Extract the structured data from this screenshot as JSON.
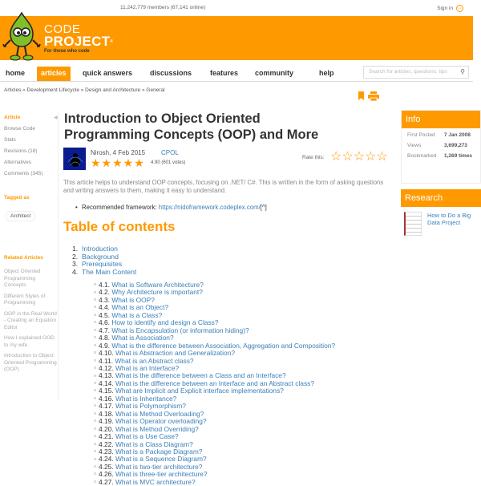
{
  "header": {
    "members": "11,242,779 members (67,141 online)",
    "sign_in": "Sign in",
    "logo_code": "CODE",
    "logo_project": "PROJECT",
    "logo_reg": "®",
    "logo_tagline": "For those who code",
    "brand_color": "#ff9900"
  },
  "nav": {
    "items": [
      {
        "label": "home",
        "active": false
      },
      {
        "label": "articles",
        "active": true
      },
      {
        "label": "quick answers",
        "active": false
      },
      {
        "label": "discussions",
        "active": false
      },
      {
        "label": "features",
        "active": false
      },
      {
        "label": "community",
        "active": false
      },
      {
        "label": "help",
        "active": false
      }
    ],
    "search_placeholder": "Search for articles, questions, tips",
    "search_icon": "search-icon"
  },
  "breadcrumb": "Articles » Development Lifecycle » Design and Architecture » General",
  "left_nav": {
    "items": [
      {
        "label": "Article",
        "active": true
      },
      {
        "label": "Browse Code",
        "active": false
      },
      {
        "label": "Stats",
        "active": false
      },
      {
        "label": "Revisions (18)",
        "active": false
      },
      {
        "label": "Alternatives",
        "active": false
      },
      {
        "label": "Comments (345)",
        "active": false
      }
    ],
    "tagged_as": "Tagged as",
    "tags": [
      "Architect"
    ],
    "related_heading": "Related Articles",
    "related": [
      "Object Oriented Programming Concepts",
      "Different Styles of Programming",
      "OOP in the Real World - Creating an Equation Editor",
      "How I explained OOD to my wife",
      "Introduction to Object Oriented Programming (OOP)"
    ]
  },
  "article": {
    "title": "Introduction to Object Oriented Programming Concepts (OOP) and More",
    "author_date": "Nirosh, 4 Feb 2015",
    "license": "CPOL",
    "stars": "★★★★★",
    "rating": "4.90 (601 votes)",
    "rate_label": "Rate this:",
    "rate_stars": "☆☆☆☆☆",
    "summary": "This article helps to understand OOP concepts, focusing on .NET/ C#. This is written in the form of asking questions and writing answers to them, making it easy to understand.",
    "rec_label": "Recommended framework: ",
    "rec_link": "https://nidoframework.codeplex.com/",
    "rec_suffix": "[^]"
  },
  "toc": {
    "title": "Table of contents",
    "items": [
      {
        "num": "1.",
        "label": "Introduction"
      },
      {
        "num": "2.",
        "label": "Background"
      },
      {
        "num": "3.",
        "label": "Prerequisites"
      },
      {
        "num": "4.",
        "label": "The Main Content"
      }
    ],
    "sub_items": [
      {
        "num": "4.1.",
        "label": "What is Software Architecture?"
      },
      {
        "num": "4.2.",
        "label": "Why Architecture is important?"
      },
      {
        "num": "4.3.",
        "label": "What is OOP?"
      },
      {
        "num": "4.4.",
        "label": "What is an Object?"
      },
      {
        "num": "4.5.",
        "label": "What is a Class?"
      },
      {
        "num": "4.6.",
        "label": "How to identify and design a Class?"
      },
      {
        "num": "4.7.",
        "label": "What is Encapsulation (or information hiding)?"
      },
      {
        "num": "4.8.",
        "label": "What is Association?"
      },
      {
        "num": "4.9.",
        "label": "What is the difference between Association, Aggregation and Composition?"
      },
      {
        "num": "4.10.",
        "label": "What is Abstraction and Generalization?"
      },
      {
        "num": "4.11.",
        "label": "What is an Abstract class?"
      },
      {
        "num": "4.12.",
        "label": "What is an Interface?"
      },
      {
        "num": "4.13.",
        "label": "What is the difference between a Class and an Interface?"
      },
      {
        "num": "4.14.",
        "label": "What is the difference between an Interface and an Abstract class?"
      },
      {
        "num": "4.15.",
        "label": "What are Implicit and Explicit interface implementations?"
      },
      {
        "num": "4.16.",
        "label": "What is Inheritance?"
      },
      {
        "num": "4.17.",
        "label": "What is Polymorphism?"
      },
      {
        "num": "4.18.",
        "label": "What is Method Overloading?"
      },
      {
        "num": "4.19.",
        "label": "What is Operator overloading?"
      },
      {
        "num": "4.20.",
        "label": "What is Method Overriding?"
      },
      {
        "num": "4.21.",
        "label": "What is a Use Case?"
      },
      {
        "num": "4.22.",
        "label": "What is a Class Diagram?"
      },
      {
        "num": "4.23.",
        "label": "What is a Package Diagram?"
      },
      {
        "num": "4.24.",
        "label": "What is a Sequence Diagram?"
      },
      {
        "num": "4.25.",
        "label": "What is two-tier architecture?"
      },
      {
        "num": "4.26.",
        "label": "What is three-tier architecture?"
      },
      {
        "num": "4.27.",
        "label": "What is MVC architecture?"
      }
    ]
  },
  "info": {
    "heading": "Info",
    "rows": [
      {
        "label": "First Posted",
        "value": "7 Jan 2008"
      },
      {
        "label": "Views",
        "value": "3,699,273"
      },
      {
        "label": "Bookmarked",
        "value": "1,269 times"
      }
    ]
  },
  "research": {
    "heading": "Research",
    "link": "How to Do a Big Data Project"
  }
}
